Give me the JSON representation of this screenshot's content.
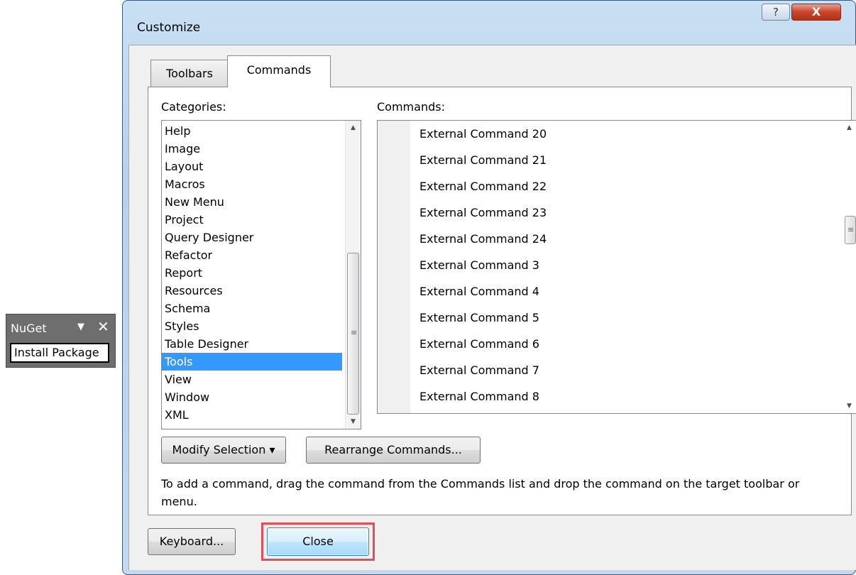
{
  "nuget_toolbar": {
    "title": "NuGet",
    "dropdown_glyph": "▼",
    "close_glyph": "✕",
    "install_button": "Install Package"
  },
  "dialog": {
    "title": "Customize",
    "help_glyph": "?",
    "close_glyph": "X"
  },
  "tabs": [
    {
      "label": "Toolbars",
      "selected": false
    },
    {
      "label": "Commands",
      "selected": true
    }
  ],
  "categories": {
    "label": "Categories:",
    "selected": "Tools",
    "items": [
      "Help",
      "Image",
      "Layout",
      "Macros",
      "New Menu",
      "Project",
      "Query Designer",
      "Refactor",
      "Report",
      "Resources",
      "Schema",
      "Styles",
      "Table Designer",
      "Tools",
      "View",
      "Window",
      "XML"
    ]
  },
  "commands": {
    "label": "Commands:",
    "items": [
      "External Command 20",
      "External Command 21",
      "External Command 22",
      "External Command 23",
      "External Command 24",
      "External Command 3",
      "External Command 4",
      "External Command 5",
      "External Command 6",
      "External Command 7",
      "External Command 8"
    ]
  },
  "buttons": {
    "modify_selection": "Modify Selection ▾",
    "rearrange_commands": "Rearrange Commands...",
    "keyboard": "Keyboard...",
    "close": "Close"
  },
  "hint_text": "To add a command, drag the command from the Commands list and drop the command on the target toolbar or menu.",
  "scrollbar_glyphs": {
    "up": "▲",
    "down": "▼",
    "grip": "≡"
  },
  "colors": {
    "selection": "#3399ff",
    "highlight_box": "#e0505a",
    "title_close": "#c9442c"
  }
}
